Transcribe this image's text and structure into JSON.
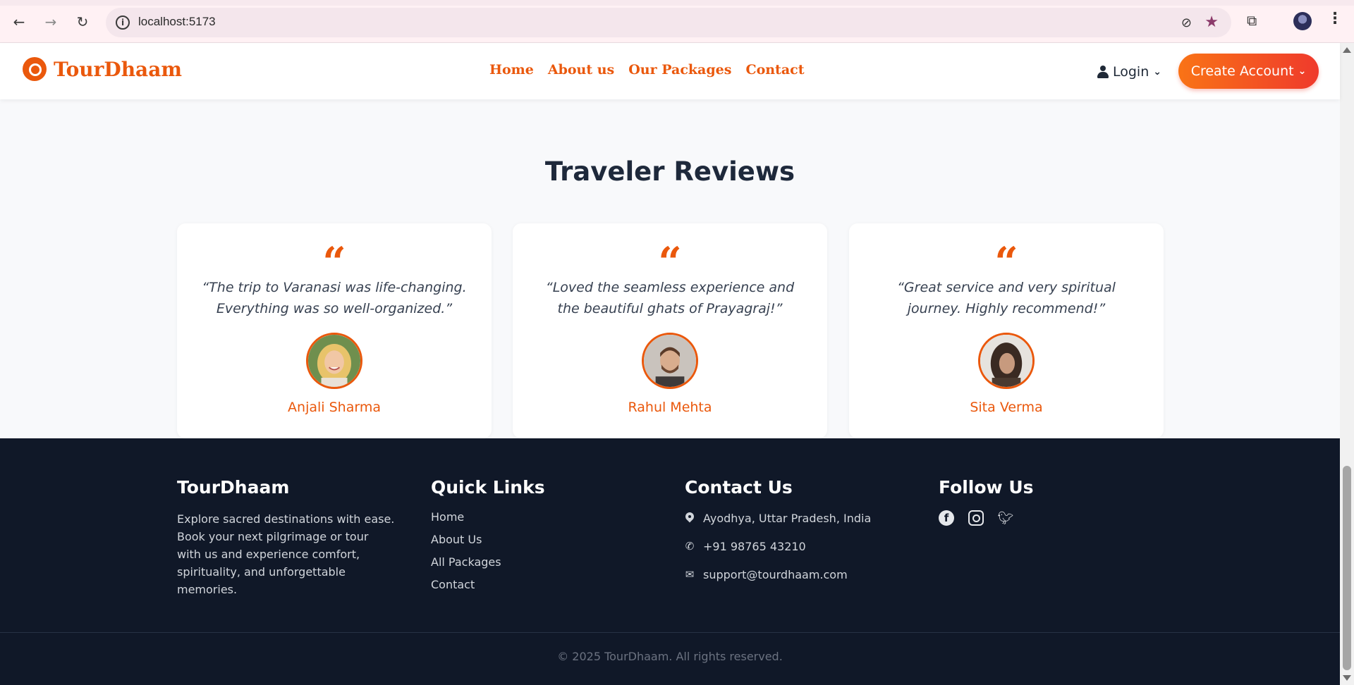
{
  "browser": {
    "url": "localhost:5173",
    "icons": [
      "back-icon",
      "forward-icon",
      "reload-icon",
      "site-info-icon",
      "eye-off-icon",
      "star-icon",
      "extensions-icon",
      "profile-avatar",
      "more-vert-icon"
    ]
  },
  "header": {
    "logo_text": "TourDhaam",
    "nav": [
      "Home",
      "About us",
      "Our Packages",
      "Contact"
    ],
    "login_label": "Login",
    "create_account_label": "Create Account"
  },
  "reviews": {
    "title": "Traveler Reviews",
    "items": [
      {
        "quote": "“The trip to Varanasi was life-changing. Everything was so well-organized.”",
        "name": "Anjali Sharma"
      },
      {
        "quote": "“Loved the seamless experience and the beautiful ghats of Prayagraj!”",
        "name": "Rahul Mehta"
      },
      {
        "quote": "“Great service and very spiritual journey. Highly recommend!”",
        "name": "Sita Verma"
      }
    ]
  },
  "footer": {
    "brand_title": "TourDhaam",
    "brand_text": "Explore sacred destinations with ease. Book your next pilgrimage or tour with us and experience comfort, spirituality, and unforgettable memories.",
    "quick_links_title": "Quick Links",
    "quick_links": [
      "Home",
      "About Us",
      "All Packages",
      "Contact"
    ],
    "contact_title": "Contact Us",
    "address": "Ayodhya, Uttar Pradesh, India",
    "phone": "+91 98765 43210",
    "email": "support@tourdhaam.com",
    "follow_title": "Follow Us",
    "social": [
      "facebook-icon",
      "instagram-icon",
      "twitter-icon"
    ],
    "copyright": "© 2025 TourDhaam. All rights reserved."
  },
  "colors": {
    "brand_orange": "#ea580c",
    "footer_bg": "#101828",
    "heading": "#1e293b"
  }
}
